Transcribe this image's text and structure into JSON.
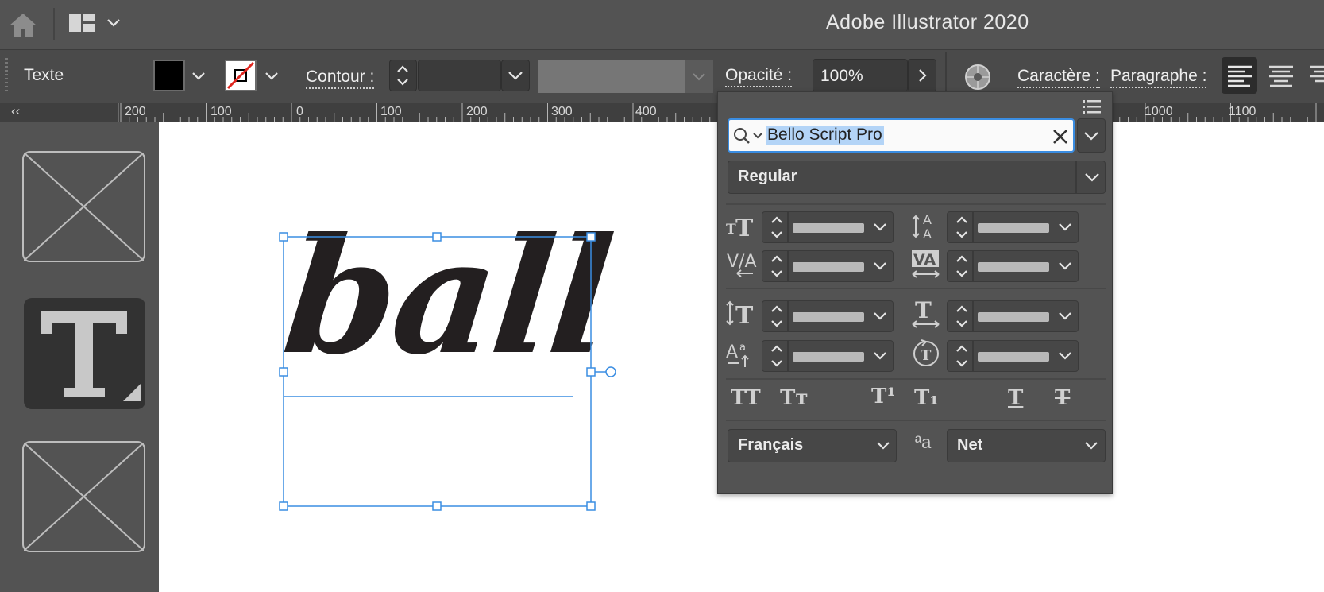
{
  "app": {
    "title": "Adobe Illustrator 2020"
  },
  "control_bar": {
    "mode_label": "Texte",
    "stroke_label": "Contour :",
    "opacity_label": "Opacité :",
    "opacity_value": "100%",
    "character_label": "Caractère :",
    "paragraph_label": "Paragraphe :",
    "fill_color": "#000000",
    "accent_red": "#e0261f"
  },
  "ruler": {
    "labels": [
      "200",
      "100",
      "0",
      "100",
      "200",
      "300",
      "400",
      "1000",
      "1100"
    ],
    "collapse_icon": "‹‹"
  },
  "canvas": {
    "text": "ball",
    "selection_color": "#3a8de2"
  },
  "character_panel": {
    "font_family": "Bello Script Pro",
    "font_style": "Regular",
    "language": "Français",
    "antialias": "Net",
    "antialias_icon_label": "ªa",
    "style_buttons": [
      "TT",
      "Tт",
      "T¹",
      "T₁",
      "T",
      "T"
    ]
  }
}
